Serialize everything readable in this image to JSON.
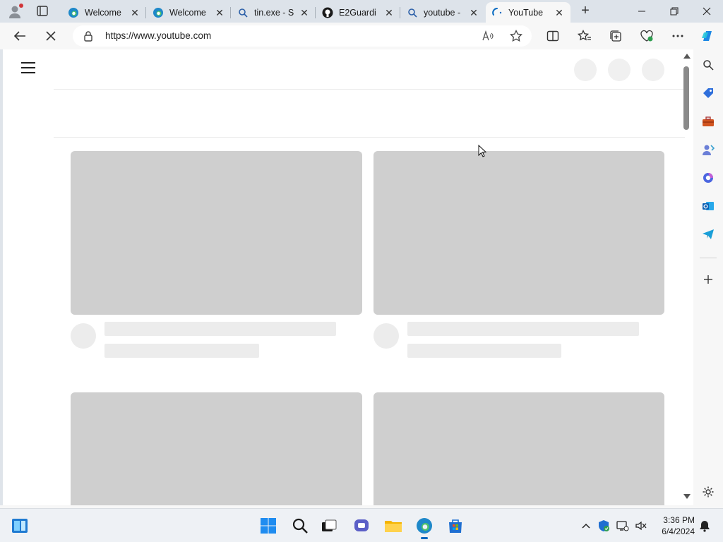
{
  "browser": {
    "tabs": [
      {
        "label": "Welcome",
        "icon": "edge-icon"
      },
      {
        "label": "Welcome",
        "icon": "edge-icon"
      },
      {
        "label": "tin.exe - S",
        "icon": "search-icon"
      },
      {
        "label": "E2Guardi",
        "icon": "github-icon"
      },
      {
        "label": "youtube -",
        "icon": "search-icon"
      },
      {
        "label": "YouTube",
        "icon": "loading-icon",
        "active": true
      }
    ],
    "address": {
      "url": "https://www.youtube.com"
    },
    "accent_color": "#0067c0"
  },
  "taskbar": {
    "clock": {
      "time": "3:36 PM",
      "date": "6/4/2024"
    }
  }
}
